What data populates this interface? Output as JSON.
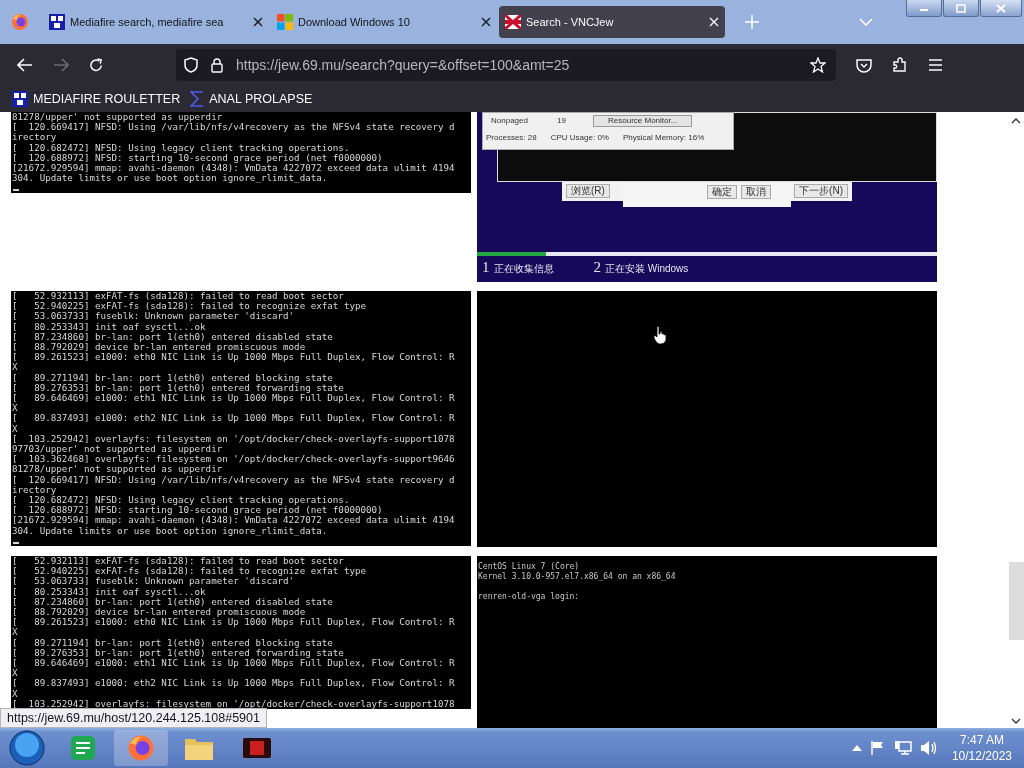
{
  "browser": {
    "tabs": [
      {
        "title": "Mediafire search, mediafire sea",
        "selected": false
      },
      {
        "title": "Download Windows 10",
        "selected": false
      },
      {
        "title": "Search - VNCJew",
        "selected": true
      }
    ],
    "url": "https://jew.69.mu/search?query=&offset=100&amt=25",
    "bookmarks": [
      {
        "label": "MEDIAFIRE ROULETTER"
      },
      {
        "label": "ANAL PROLAPSE"
      }
    ]
  },
  "results": [
    {
      "left": {
        "kind": "terminal",
        "cursor": true,
        "lines": [
          "81278/upper' not supported as upperdir",
          "[  120.669417] NFSD: Using /var/lib/nfs/v4recovery as the NFSv4 state recovery d",
          "irectory",
          "[  120.682472] NFSD: Using legacy client tracking operations.",
          "[  120.688972] NFSD: starting 10-second grace period (net f0000000)",
          "[21672.929594] mmap: avahi-daemon (4348): VmData 4227072 exceed data ulimit 4194",
          "304. Update limits or use boot option ignore_rlimit_data."
        ]
      },
      "right": {
        "kind": "setup_screen",
        "task_manager": {
          "label": "Nonpaged",
          "value": "19",
          "button": "Resource Monitor...",
          "status": [
            "Processes: 28",
            "CPU Usage: 0%",
            "Physical Memory: 16%"
          ]
        },
        "dialog_buttons": [
          "浏览(R)",
          "下一步(N)"
        ],
        "confirm_buttons": [
          "确定",
          "取消"
        ],
        "progress": {
          "level": 0.15
        },
        "steps": [
          {
            "number": "1",
            "label": "正在收集信息"
          },
          {
            "number": "2",
            "label": "正在安装 Windows"
          }
        ]
      }
    },
    {
      "left": {
        "kind": "terminal",
        "cursor": true,
        "lines": [
          "[   52.932113] exFAT-fs (sda128): failed to read boot sector",
          "[   52.940225] exFAT-fs (sda128): failed to recognize exfat type",
          "[   53.063733] fuseblk: Unknown parameter 'discard'",
          "[   80.253343] init oaf sysctl...ok",
          "[   87.234860] br-lan: port 1(eth0) entered disabled state",
          "[   88.792029] device br-lan entered promiscuous mode",
          "[   89.261523] e1000: eth0 NIC Link is Up 1000 Mbps Full Duplex, Flow Control: R",
          "X",
          "[   89.271194] br-lan: port 1(eth0) entered blocking state",
          "[   89.276353] br-lan: port 1(eth0) entered forwarding state",
          "[   89.646469] e1000: eth1 NIC Link is Up 1000 Mbps Full Duplex, Flow Control: R",
          "X",
          "[   89.837493] e1000: eth2 NIC Link is Up 1000 Mbps Full Duplex, Flow Control: R",
          "X",
          "[  103.252942] overlayfs: filesystem on '/opt/docker/check-overlayfs-support1078",
          "97703/upper' not supported as upperdir",
          "[  103.362468] overlayfs: filesystem on '/opt/docker/check-overlayfs-support9646",
          "81278/upper' not supported as upperdir",
          "[  120.669417] NFSD: Using /var/lib/nfs/v4recovery as the NFSv4 state recovery d",
          "irectory",
          "[  120.682472] NFSD: Using legacy client tracking operations.",
          "[  120.688972] NFSD: starting 10-second grace period (net f0000000)",
          "[21672.929594] mmap: avahi-daemon (4348): VmData 4227072 exceed data ulimit 4194",
          "304. Update limits or use boot option ignore_rlimit_data."
        ]
      },
      "right": {
        "kind": "blank_screen"
      }
    },
    {
      "left": {
        "kind": "terminal",
        "cursor": false,
        "lines": [
          "[   52.932113] exFAT-fs (sda128): failed to read boot sector",
          "[   52.940225] exFAT-fs (sda128): failed to recognize exfat type",
          "[   53.063733] fuseblk: Unknown parameter 'discard'",
          "[   80.253343] init oaf sysctl...ok",
          "[   87.234860] br-lan: port 1(eth0) entered disabled state",
          "[   88.792029] device br-lan entered promiscuous mode",
          "[   89.261523] e1000: eth0 NIC Link is Up 1000 Mbps Full Duplex, Flow Control: R",
          "X",
          "[   89.271194] br-lan: port 1(eth0) entered blocking state",
          "[   89.276353] br-lan: port 1(eth0) entered forwarding state",
          "[   89.646469] e1000: eth1 NIC Link is Up 1000 Mbps Full Duplex, Flow Control: R",
          "X",
          "[   89.837493] e1000: eth2 NIC Link is Up 1000 Mbps Full Duplex, Flow Control: R",
          "X",
          "[  103.252942] overlayfs: filesystem on '/opt/docker/check-overlayfs-support1078"
        ]
      },
      "right": {
        "kind": "console_screen",
        "banner": [
          "CentOS Linux 7 (Core)",
          "Kernel 3.10.0-957.el7.x86_64 on an x86_64"
        ],
        "prompt": "renren-old-vga login:"
      }
    }
  ],
  "status_link": "https://jew.69.mu/host/120.244.125.108#5901",
  "taskbar": {
    "time": "7:47 AM",
    "date": "10/12/2023"
  }
}
